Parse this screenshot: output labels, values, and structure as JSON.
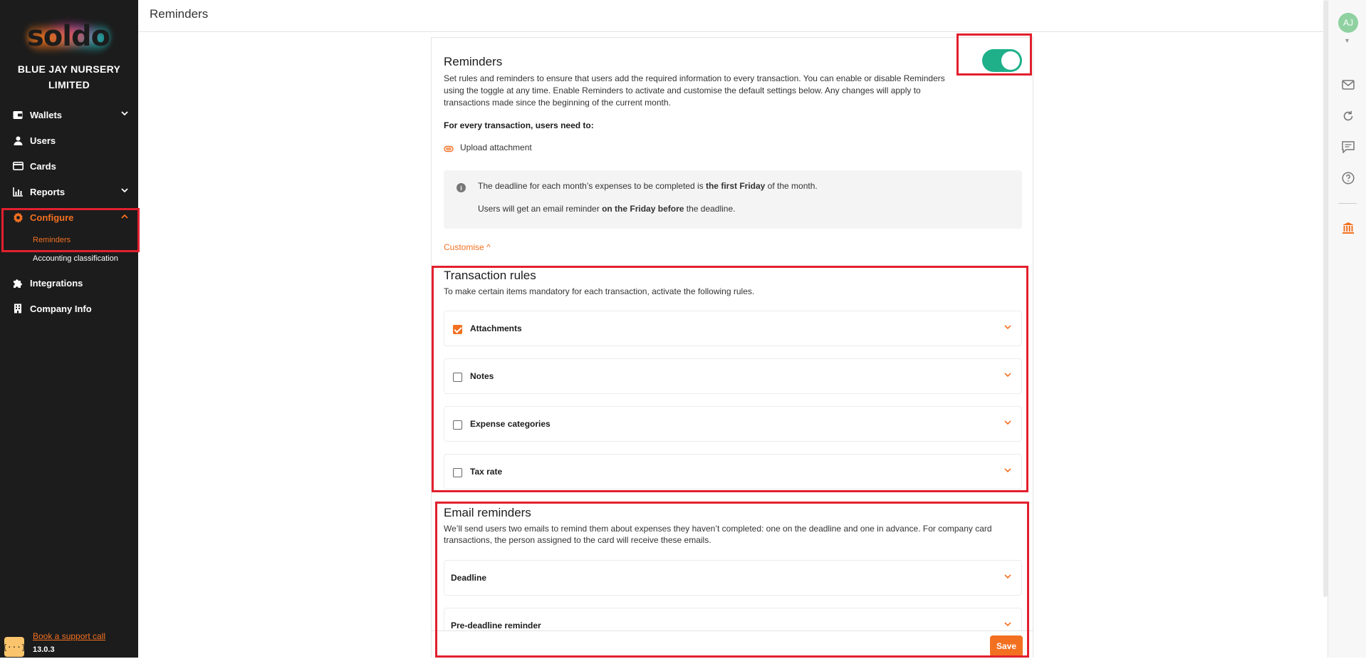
{
  "sidebar": {
    "logo_text": "soldo",
    "company_name": "BLUE JAY NURSERY LIMITED",
    "nav": {
      "wallets": "Wallets",
      "users": "Users",
      "cards": "Cards",
      "reports": "Reports",
      "configure": "Configure",
      "integrations": "Integrations",
      "company_info": "Company Info"
    },
    "configure_sub": {
      "reminders": "Reminders",
      "accounting": "Accounting classification"
    },
    "support_badge": "{···}",
    "support_link": "Book a support call",
    "version": "13.0.3"
  },
  "header": {
    "title": "Reminders"
  },
  "rail": {
    "avatar_initials": "AJ"
  },
  "reminders": {
    "title": "Reminders",
    "enabled": true,
    "description_1": "Set rules and reminders to ensure that users add the required information to every transaction. You can enable or disable Reminders",
    "description_2": "using the toggle at any time. Enable Reminders to activate and customise the default settings below. Any changes will apply to",
    "description_3": "transactions made since the beginning of the current month.",
    "requirement_heading": "For every transaction, users need to:",
    "requirement_item": "Upload attachment",
    "info": {
      "line1_pre": "The deadline for each month’s expenses to be completed is ",
      "line1_bold": "the first Friday",
      "line1_post": " of the month.",
      "line2_pre": "Users will get an email reminder ",
      "line2_bold": "on the Friday before",
      "line2_post": " the deadline."
    },
    "customise": "Customise ^"
  },
  "transaction_rules": {
    "title": "Transaction rules",
    "subtitle": "To make certain items mandatory for each transaction, activate the following rules.",
    "rules": [
      {
        "label": "Attachments",
        "checked": true
      },
      {
        "label": "Notes",
        "checked": false
      },
      {
        "label": "Expense categories",
        "checked": false
      },
      {
        "label": "Tax rate",
        "checked": false
      }
    ]
  },
  "email_reminders": {
    "title": "Email reminders",
    "subtitle_1": "We’ll send users two emails to remind them about expenses they haven’t completed: one on the deadline and one in advance. For company card",
    "subtitle_2": "transactions, the person assigned to the card will receive these emails.",
    "items": [
      {
        "label": "Deadline"
      },
      {
        "label": "Pre-deadline reminder"
      }
    ]
  },
  "footer": {
    "save_label": "Save"
  },
  "colors": {
    "accent": "#f37021",
    "toggle_on": "#1fb08a",
    "highlight": "#e2202e",
    "sidebar_bg": "#1c1c1c"
  }
}
